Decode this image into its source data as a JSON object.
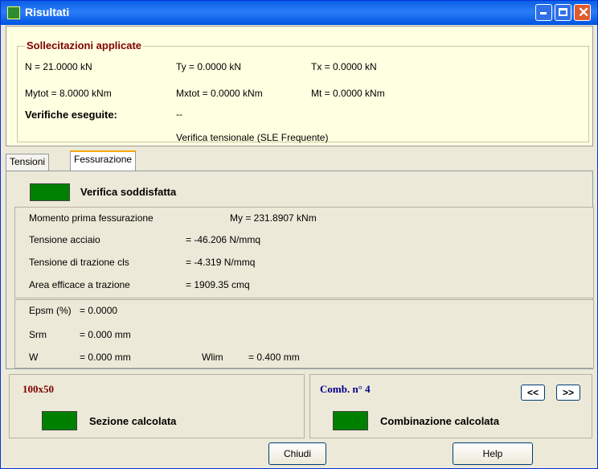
{
  "window": {
    "title": "Risultati"
  },
  "applied": {
    "legend": "Sollecitazioni applicate",
    "n": "N = 21.0000 kN",
    "ty": "Ty = 0.0000 kN",
    "tx": "Tx = 0.0000 kN",
    "mytot": "Mytot = 8.0000 kNm",
    "mxtot": "Mxtot = 0.0000 kNm",
    "mt": "Mt = 0.0000 kNm",
    "verifications_label": "Verifiche eseguite:",
    "dash": "--",
    "verification_type": "Verifica tensionale (SLE Frequente)"
  },
  "tabs": [
    "Tensioni",
    "Fessurazione"
  ],
  "result": {
    "status": "Verifica soddisfatta",
    "status_color": "#008000"
  },
  "values": {
    "moment_label": "Momento prima fessurazione",
    "moment_value": "My = 231.8907 kNm",
    "steel_label": "Tensione acciaio",
    "steel_value": "= -46.206 N/mmq",
    "cls_label": "Tensione di trazione cls",
    "cls_value": "= -4.319 N/mmq",
    "area_label": "Area efficace a trazione",
    "area_value": "= 1909.35 cmq"
  },
  "crack": {
    "epsm_label": "Epsm (%)",
    "epsm_value": "= 0.0000",
    "srm_label": "Srm",
    "srm_value": "= 0.000 mm",
    "w_label": "W",
    "w_value": "= 0.000 mm",
    "wlim_label": "Wlim",
    "wlim_value": "= 0.400 mm"
  },
  "section": {
    "name": "100x50",
    "status": "Sezione calcolata"
  },
  "combination": {
    "label": "Comb. n° 4",
    "prev": "<<",
    "next": ">>",
    "status": "Combinazione calcolata"
  },
  "buttons": {
    "close": "Chiudi",
    "help": "Help"
  }
}
